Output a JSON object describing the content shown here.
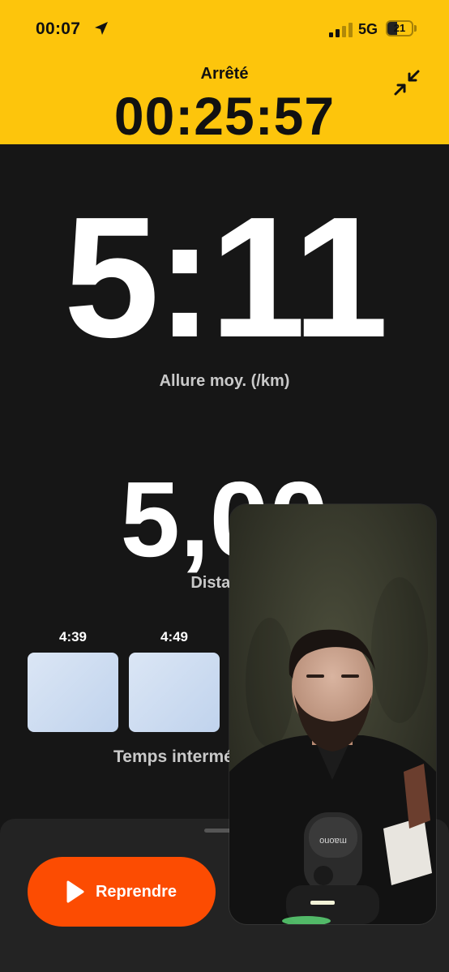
{
  "status_bar": {
    "time": "00:07",
    "network": "5G",
    "battery": "21"
  },
  "header": {
    "state": "Arrêté",
    "elapsed": "00:25:57"
  },
  "pace": {
    "value": "5:11",
    "label": "Allure moy. (/km)"
  },
  "distance": {
    "value": "5,00",
    "label": "Distance"
  },
  "splits": {
    "times": [
      "4:39",
      "4:49"
    ],
    "label": "Temps intermédiaires"
  },
  "actions": {
    "resume_label": "Reprendre"
  },
  "colors": {
    "header": "#FDC50C",
    "background": "#161616",
    "resume": "#FC4C02",
    "split_bar": "#C9D9EF"
  },
  "pip_video": {
    "mic_brand": "maono"
  }
}
